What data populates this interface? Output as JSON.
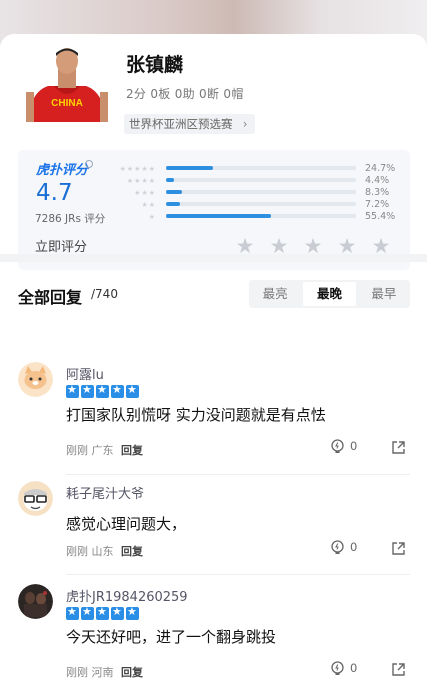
{
  "player": {
    "name": "张镇麟",
    "stats": "2分 0板 0助 0断 0帽",
    "event": "世界杯亚洲区预选赛",
    "jersey_text": "CHINA"
  },
  "rating": {
    "brand": "虎扑评分",
    "score": "4.7",
    "count": "7286 JRs 评分",
    "rate_now": "立即评分",
    "distribution": [
      {
        "stars": "★★★★★",
        "percent": "24.7%",
        "value": 24.7
      },
      {
        "stars": "★★★★",
        "percent": "4.4%",
        "value": 4.4
      },
      {
        "stars": "★★★",
        "percent": "8.3%",
        "value": 8.3
      },
      {
        "stars": "★★",
        "percent": "7.2%",
        "value": 7.2
      },
      {
        "stars": "★",
        "percent": "55.4%",
        "value": 55.4
      }
    ]
  },
  "replies": {
    "title": "全部回复",
    "count": "/740",
    "tabs": [
      "最亮",
      "最晚",
      "最早"
    ],
    "active_tab": "最晚"
  },
  "comments": [
    {
      "user": "阿露lu",
      "rating": 5,
      "text": "打国家队别慌呀 实力没问题就是有点怯",
      "time": "刚刚",
      "location": "广东",
      "reply": "回复",
      "likes": "0",
      "avatar": "cat-avatar"
    },
    {
      "user": "耗子尾汁大爷",
      "rating": 0,
      "text": "感觉心理问题大，",
      "time": "刚刚",
      "location": "山东",
      "reply": "回复",
      "likes": "0",
      "avatar": "glasses-avatar"
    },
    {
      "user": "虎扑JR1984260259",
      "rating": 5,
      "text": "今天还好吧，进了一个翻身跳投",
      "time": "刚刚",
      "location": "河南",
      "reply": "回复",
      "likes": "0",
      "avatar": "dark-photo-avatar"
    }
  ],
  "colors": {
    "accent": "#2a8ee6",
    "score": "#1a6fd4"
  }
}
